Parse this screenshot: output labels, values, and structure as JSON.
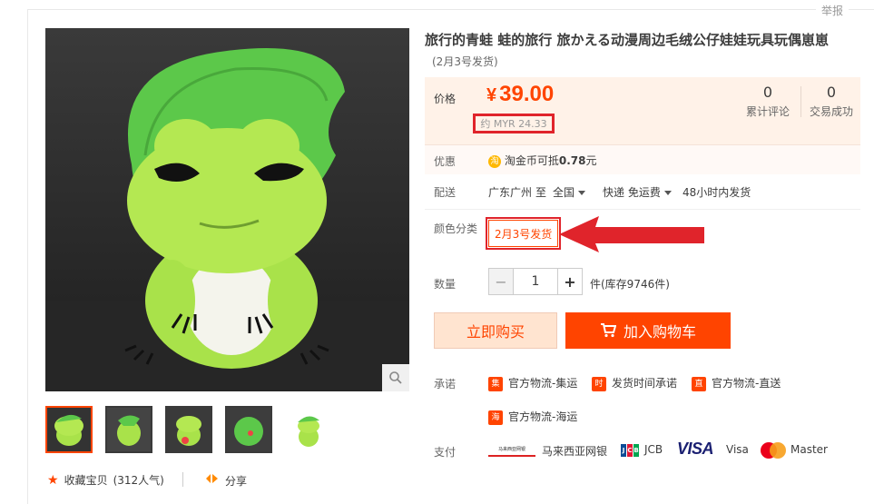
{
  "header": {
    "report_label": "举报"
  },
  "gallery": {
    "zoom_icon": "search-icon",
    "thumbnail_count": 5
  },
  "actions": {
    "favorite_label": "收藏宝贝",
    "favorite_count": "(312人气)",
    "share_label": "分享"
  },
  "product": {
    "title": "旅行的青蛙 蛙的旅行 旅かえる动漫周边毛绒公仔娃娃玩具玩偶崽崽",
    "subtitle": "(2月3号发货)",
    "price_label": "价格",
    "currency_symbol": "¥",
    "price": "39.00",
    "myr_price": "约 MYR 24.33",
    "stats": [
      {
        "num": "0",
        "label": "累计评论"
      },
      {
        "num": "0",
        "label": "交易成功"
      }
    ]
  },
  "promo": {
    "label": "优惠",
    "coin_icon": "淘",
    "text_prefix": "淘金币可抵",
    "amount": "0.78",
    "text_suffix": "元"
  },
  "shipping": {
    "label": "配送",
    "origin": "广东广州",
    "to": "至",
    "destination": "全国",
    "method": "快递 免运费",
    "dispatch": "48小时内发货"
  },
  "sku": {
    "label": "颜色分类",
    "option": "2月3号发货"
  },
  "quantity": {
    "label": "数量",
    "value": "1",
    "minus": "−",
    "plus": "+",
    "stock": "件(库存9746件)"
  },
  "buttons": {
    "buy_now": "立即购买",
    "add_to_cart": "加入购物车"
  },
  "promise": {
    "label": "承诺",
    "items": [
      "官方物流-集运",
      "发货时间承诺",
      "官方物流-直送",
      "官方物流-海运"
    ]
  },
  "payment": {
    "label": "支付",
    "methods": [
      "马来西亚网银",
      "JCB",
      "Visa",
      "Master"
    ],
    "visa_logo": "VISA",
    "bank_logo_text": "马来西亚网银"
  },
  "colors": {
    "accent": "#ff4400",
    "annotation_red": "#e0242b",
    "price_bg": "#fff2e8"
  }
}
